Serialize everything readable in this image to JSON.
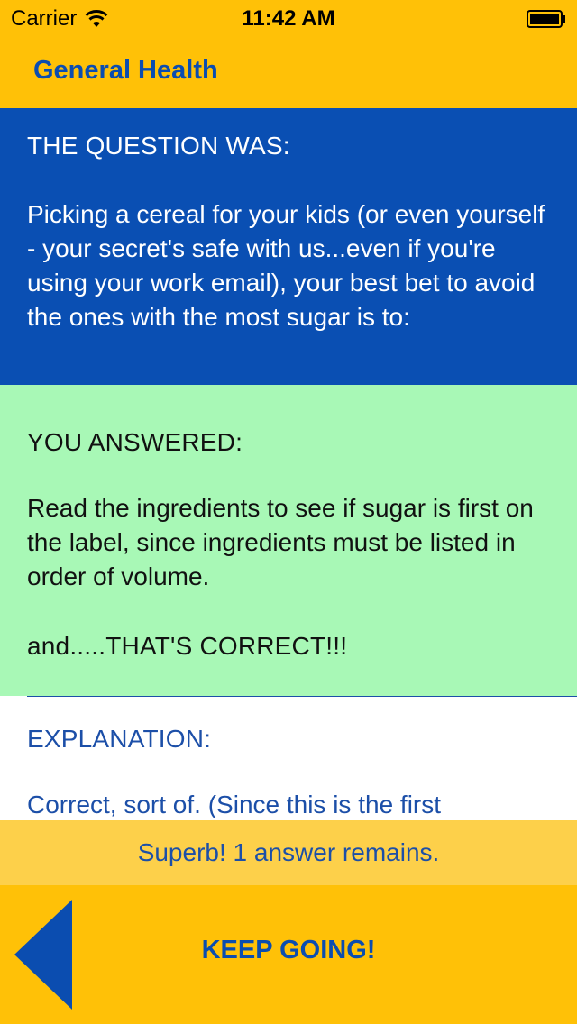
{
  "status_bar": {
    "carrier": "Carrier",
    "time": "11:42 AM",
    "icons": [
      "wifi-icon",
      "battery-icon"
    ]
  },
  "nav": {
    "title": "General Health"
  },
  "question": {
    "heading": "THE QUESTION WAS:",
    "text": "Picking a cereal for your kids (or even yourself - your secret's safe with us...even if you're using your work email), your best bet to avoid the ones with the most sugar is to:"
  },
  "answer": {
    "heading": "YOU ANSWERED:",
    "text": "Read the ingredients to see if sugar is first on the label, since ingredients must be listed in order of volume.",
    "result": "and.....THAT'S CORRECT!!!"
  },
  "explanation": {
    "heading": "EXPLANATION:",
    "text": "Correct, sort of.  (Since this is the first"
  },
  "progress": {
    "message": "Superb! 1 answer remains."
  },
  "footer": {
    "back_icon": "back-triangle-icon",
    "keep_going_label": "KEEP GOING!"
  },
  "colors": {
    "header_yellow": "#FFC107",
    "question_blue": "#0A4FB3",
    "answer_green": "#A8F8B6",
    "strip_yellow": "#FDD04A",
    "text_blue": "#1C4FA8"
  }
}
